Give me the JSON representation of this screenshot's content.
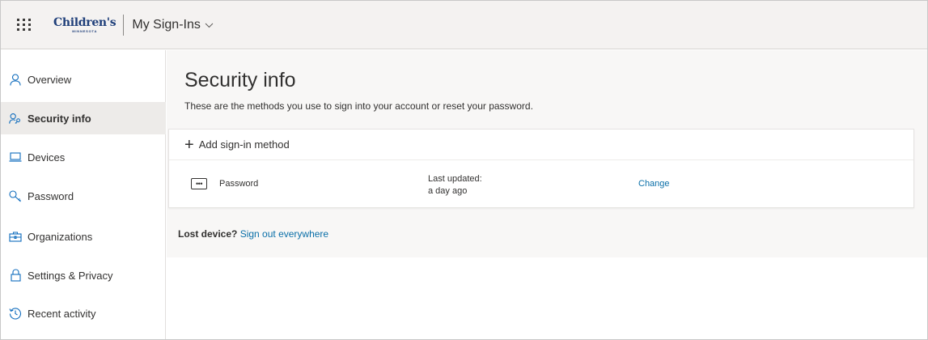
{
  "header": {
    "logo_text": "Children's",
    "logo_subtext": "MINNESOTA",
    "app_title": "My Sign-Ins"
  },
  "sidebar": {
    "items": [
      {
        "label": "Overview",
        "icon": "person-icon",
        "active": false
      },
      {
        "label": "Security info",
        "icon": "security-key-icon",
        "active": true
      },
      {
        "label": "Devices",
        "icon": "laptop-icon",
        "active": false
      },
      {
        "label": "Password",
        "icon": "key-icon",
        "active": false
      },
      {
        "label": "Organizations",
        "icon": "briefcase-icon",
        "active": false
      },
      {
        "label": "Settings & Privacy",
        "icon": "lock-icon",
        "active": false
      },
      {
        "label": "Recent activity",
        "icon": "history-icon",
        "active": false
      }
    ]
  },
  "main": {
    "title": "Security info",
    "description": "These are the methods you use to sign into your account or reset your password.",
    "add_method_label": "Add sign-in method",
    "methods": [
      {
        "name": "Password",
        "icon": "password-dots-icon",
        "updated_label": "Last updated:",
        "updated_value": "a day ago",
        "action_label": "Change"
      }
    ],
    "lost_device_prefix": "Lost device?",
    "lost_device_link": "Sign out everywhere"
  },
  "colors": {
    "topbar_bg": "#f4f2f1",
    "content_bg": "#f8f7f6",
    "active_nav_bg": "#edebe9",
    "link": "#0a6fa8",
    "icon_blue": "#0f6cbd"
  }
}
